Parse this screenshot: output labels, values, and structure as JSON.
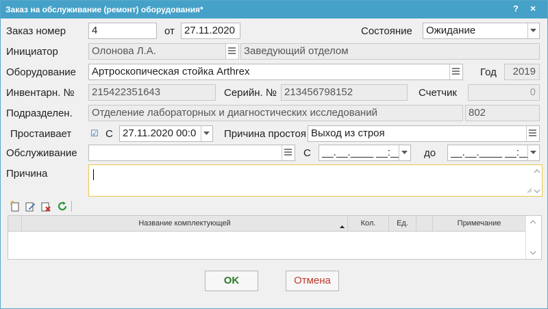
{
  "window": {
    "title": "Заказ на обслуживание (ремонт) оборудования*",
    "help": "?",
    "close": "×"
  },
  "order": {
    "number_label": "Заказ номер",
    "number": "4",
    "from_label": "от",
    "date": "27.11.2020"
  },
  "status": {
    "label": "Состояние",
    "value": "Ожидание"
  },
  "initiator": {
    "label": "Инициатор",
    "name": "Олонова Л.А.",
    "position": "Заведующий отделом"
  },
  "equipment": {
    "label": "Оборудование",
    "value": "Артроскопическая стойка Arthrex",
    "year_label": "Год",
    "year": "2019"
  },
  "inventory": {
    "label": "Инвентарн. №",
    "value": "215422351643",
    "serial_label": "Серийн. №",
    "serial": "213456798152",
    "counter_label": "Счетчик",
    "counter": "0"
  },
  "division": {
    "label": "Подразделен.",
    "value": "Отделение лабораторных и диагностических исследований",
    "code": "802"
  },
  "downtime": {
    "label": "Простаивает",
    "check": "☑",
    "from_label": "С",
    "from_value": "27.11.2020 00:0",
    "reason_label": "Причина простоя",
    "reason": "Выход из строя"
  },
  "service": {
    "label": "Обслуживание",
    "value": "",
    "from_label": "С",
    "from_value": "__.__.____ __:__",
    "to_label": "до",
    "to_value": "__.__.____ __:__"
  },
  "cause": {
    "label": "Причина",
    "value": ""
  },
  "grid": {
    "columns": [
      "",
      "Название комплектующей",
      "Кол.",
      "Ед.",
      "",
      "Примечание"
    ]
  },
  "buttons": {
    "ok": "OK",
    "cancel": "Отмена"
  },
  "colors": {
    "titlebar": "#45a1c8",
    "ok_text": "#2a7a2a",
    "cancel_text": "#c0392b",
    "focus_border": "#e8c84a",
    "grid_header": "#e6e6e6"
  }
}
